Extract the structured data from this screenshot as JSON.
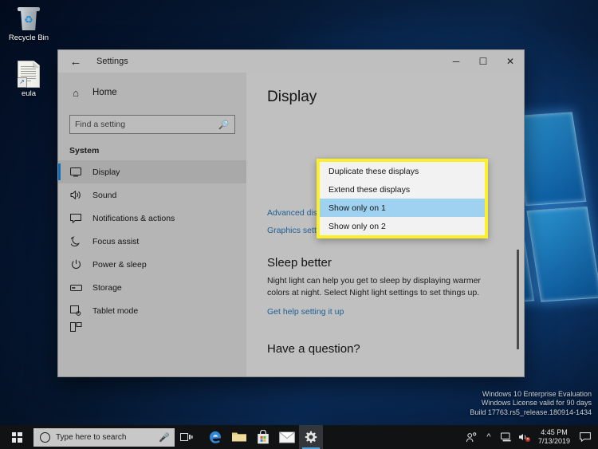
{
  "desktop": {
    "icons": [
      {
        "name": "recycle-bin",
        "label": "Recycle Bin"
      },
      {
        "name": "eula-file",
        "label": "eula"
      }
    ],
    "watermark": {
      "line1": "Windows 10 Enterprise Evaluation",
      "line2": "Windows License valid for 90 days",
      "line3": "Build 17763.rs5_release.180914-1434"
    }
  },
  "window": {
    "title": "Settings",
    "back_label": "←",
    "controls": {
      "minimize": "─",
      "maximize": "☐",
      "close": "✕"
    }
  },
  "sidebar": {
    "home_label": "Home",
    "home_icon": "home-icon",
    "search": {
      "placeholder": "Find a setting",
      "value": "",
      "icon": "search-icon"
    },
    "group_label": "System",
    "items": [
      {
        "label": "Display",
        "icon": "monitor-icon",
        "selected": true
      },
      {
        "label": "Sound",
        "icon": "speaker-icon",
        "selected": false
      },
      {
        "label": "Notifications & actions",
        "icon": "notification-icon",
        "selected": false
      },
      {
        "label": "Focus assist",
        "icon": "moon-icon",
        "selected": false
      },
      {
        "label": "Power & sleep",
        "icon": "power-icon",
        "selected": false
      },
      {
        "label": "Storage",
        "icon": "drive-icon",
        "selected": false
      },
      {
        "label": "Tablet mode",
        "icon": "tablet-icon",
        "selected": false
      }
    ]
  },
  "content": {
    "page_title": "Display",
    "links": [
      {
        "label": "Advanced display settings",
        "name": "advanced-display-settings-link"
      },
      {
        "label": "Graphics settings",
        "name": "graphics-settings-link"
      }
    ],
    "sleep_section": {
      "heading": "Sleep better",
      "body": "Night light can help you get to sleep by displaying warmer colors at night. Select Night light settings to set things up.",
      "link": "Get help setting it up"
    },
    "question_section": {
      "heading": "Have a question?"
    }
  },
  "dropdown": {
    "name": "display-mode-dropdown",
    "highlight_color": "#9ed2f0",
    "border_color": "#fcf028",
    "items": [
      {
        "label": "Duplicate these displays",
        "highlighted": false
      },
      {
        "label": "Extend these displays",
        "highlighted": false
      },
      {
        "label": "Show only on 1",
        "highlighted": true
      },
      {
        "label": "Show only on 2",
        "highlighted": false
      }
    ]
  },
  "taskbar": {
    "start_label": "Start",
    "search_placeholder": "Type here to search",
    "search_value": "",
    "buttons": [
      {
        "name": "task-view-button",
        "label": "Task View"
      },
      {
        "name": "edge-button",
        "label": "Microsoft Edge"
      },
      {
        "name": "file-explorer-button",
        "label": "File Explorer"
      },
      {
        "name": "store-button",
        "label": "Microsoft Store"
      },
      {
        "name": "mail-button",
        "label": "Mail"
      },
      {
        "name": "settings-button",
        "label": "Settings"
      }
    ],
    "tray": {
      "people_icon": "people-icon",
      "chevron_icon": "chevron-up-icon",
      "network_icon": "network-icon",
      "volume_icon": "volume-muted-icon",
      "action_center_icon": "action-center-icon"
    },
    "clock": {
      "time": "4:45 PM",
      "date": "7/13/2019"
    }
  }
}
